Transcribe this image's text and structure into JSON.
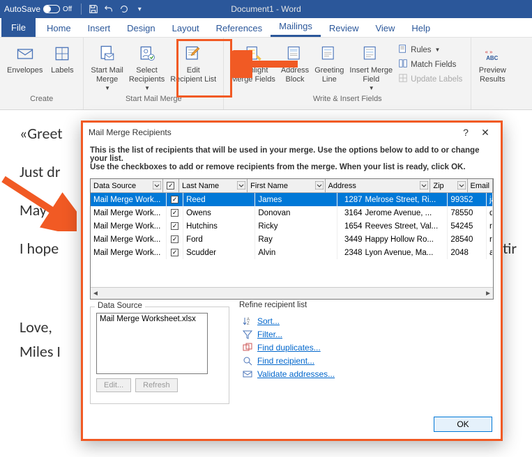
{
  "titlebar": {
    "autosave_label": "AutoSave",
    "autosave_state": "Off",
    "doc_title": "Document1 - Word"
  },
  "tabs": {
    "file": "File",
    "home": "Home",
    "insert": "Insert",
    "design": "Design",
    "layout": "Layout",
    "references": "References",
    "mailings": "Mailings",
    "review": "Review",
    "view": "View",
    "help": "Help"
  },
  "ribbon": {
    "create": {
      "label": "Create",
      "envelopes": "Envelopes",
      "labels": "Labels"
    },
    "start": {
      "label": "Start Mail Merge",
      "start_mail_merge": "Start Mail\nMerge",
      "select_recipients": "Select\nRecipients",
      "edit_recipient_list": "Edit\nRecipient List"
    },
    "write": {
      "label": "Write & Insert Fields",
      "highlight": "Highlight\nMerge Fields",
      "address": "Address\nBlock",
      "greeting": "Greeting\nLine",
      "insert_field": "Insert Merge\nField",
      "rules": "Rules",
      "match": "Match Fields",
      "update": "Update Labels"
    },
    "preview": {
      "preview_results": "Preview\nResults"
    }
  },
  "doc": {
    "l1": "«Greet",
    "l2": "Just dr",
    "l3": "May y",
    "l4": "I hope",
    "l4_r": "tir",
    "l5": "Love,",
    "l6": "Miles I"
  },
  "dialog": {
    "title": "Mail Merge Recipients",
    "help": "?",
    "close": "✕",
    "body1": "This is the list of recipients that will be used in your merge.  Use the options below to add to or change your list.",
    "body2": "Use the checkboxes to add or remove recipients from the merge.  When your list is ready, click OK.",
    "cols": {
      "ds": "Data Source",
      "ln": "Last Name",
      "fn": "First Name",
      "addr": "Address",
      "zip": "Zip",
      "em": "Email"
    },
    "rows": [
      {
        "ds": "Mail Merge Work...",
        "ln": "Reed",
        "fn": "James",
        "num": "1287",
        "street": "Melrose Street, Ri...",
        "zip": "99352",
        "em": "jamesre"
      },
      {
        "ds": "Mail Merge Work...",
        "ln": "Owens",
        "fn": "Donovan",
        "num": "3164",
        "street": "Jerome Avenue, ...",
        "zip": "78550",
        "em": "donova"
      },
      {
        "ds": "Mail Merge Work...",
        "ln": "Hutchins",
        "fn": "Ricky",
        "num": "1654",
        "street": "Reeves Street, Val...",
        "zip": "54245",
        "em": "rickyhut"
      },
      {
        "ds": "Mail Merge Work...",
        "ln": "Ford",
        "fn": "Ray",
        "num": "3449",
        "street": "Happy Hollow Ro...",
        "zip": "28540",
        "em": "rayford@"
      },
      {
        "ds": "Mail Merge Work...",
        "ln": "Scudder",
        "fn": "Alvin",
        "num": "2348",
        "street": "Lyon Avenue, Ma...",
        "zip": "2048",
        "em": "alvinscu"
      }
    ],
    "ds_label": "Data Source",
    "ds_file": "Mail Merge Worksheet.xlsx",
    "ds_edit": "Edit...",
    "ds_refresh": "Refresh",
    "refine_label": "Refine recipient list",
    "refine": {
      "sort": "Sort...",
      "filter": "Filter...",
      "dup": "Find duplicates...",
      "find": "Find recipient...",
      "val": "Validate addresses..."
    },
    "ok": "OK"
  }
}
